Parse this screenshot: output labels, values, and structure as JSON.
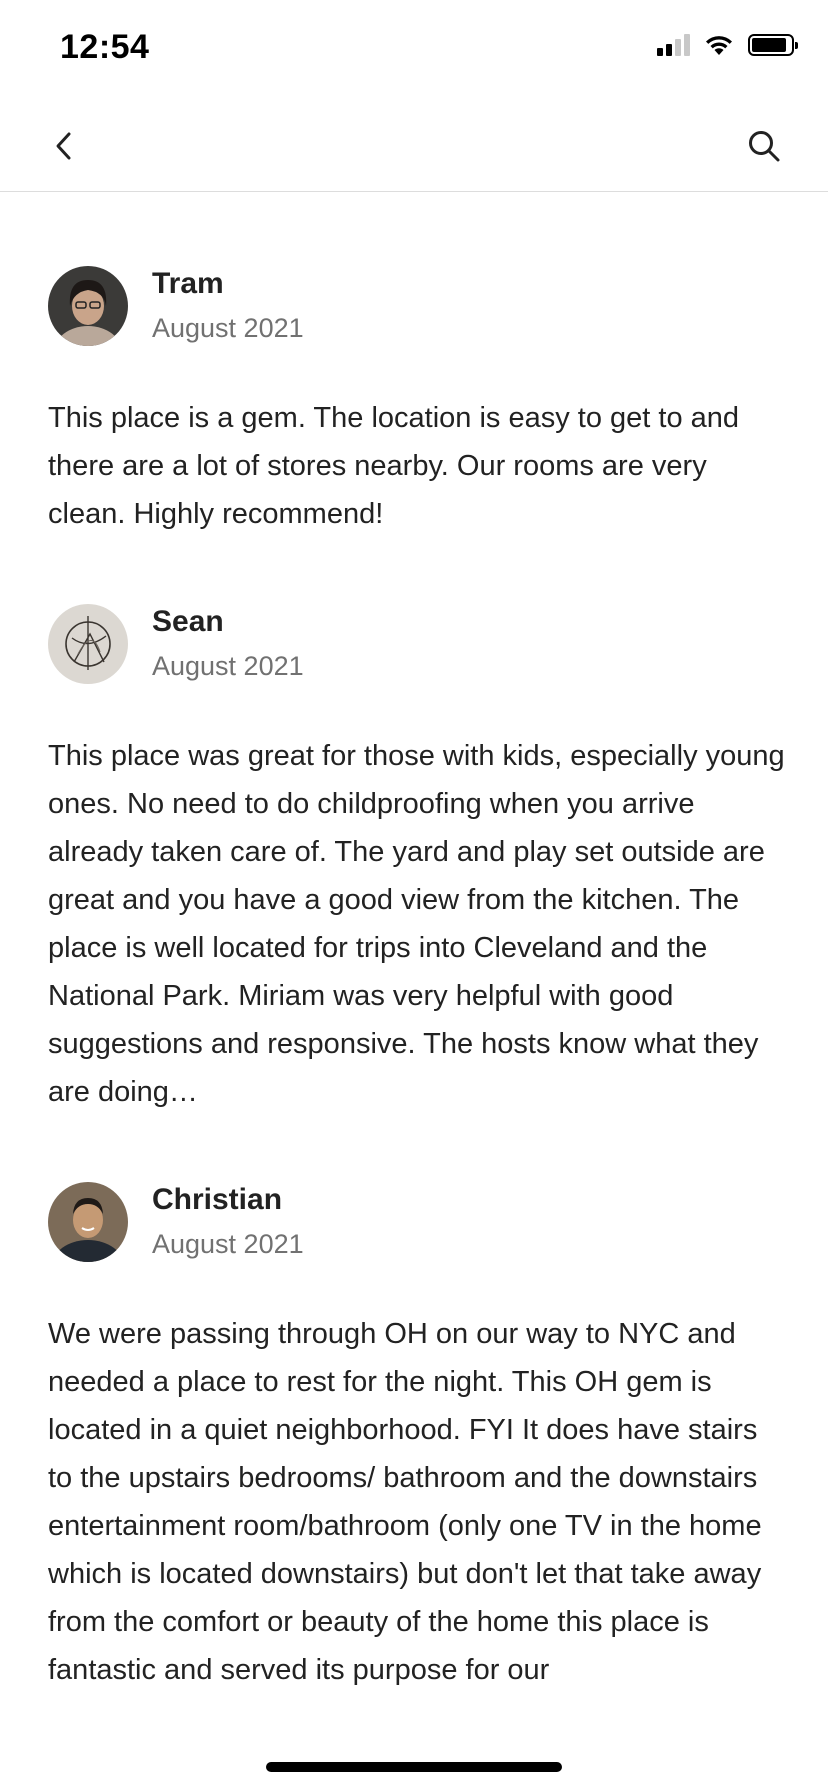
{
  "status_bar": {
    "time": "12:54",
    "icons": [
      "cellular-signal-icon",
      "wifi-icon",
      "battery-icon"
    ]
  },
  "nav": {
    "back_icon": "chevron-left-icon",
    "search_icon": "search-icon"
  },
  "colors": {
    "text_primary": "#222222",
    "text_secondary": "#717171",
    "divider": "#dddddd"
  },
  "reviews": [
    {
      "name": "Tram",
      "date": "August 2021",
      "text": "This place is a gem. The location is easy to get to and there are a lot of stores nearby. Our rooms are very clean. Highly recommend!"
    },
    {
      "name": "Sean",
      "date": "August 2021",
      "text": "This place was great for those with kids, especially young ones. No need to do childproofing when you arrive already taken care of. The yard and play set outside are great and you have a good view from the kitchen. The place is well located for trips into Cleveland and the National Park. Miriam was very helpful with good suggestions and responsive. The hosts know what they are doing…"
    },
    {
      "name": "Christian",
      "date": "August 2021",
      "text": "We were passing through OH on our way to NYC and needed a place to rest for the night. This OH gem is located in a quiet neighborhood. FYI It does have stairs to the upstairs bedrooms/ bathroom and the downstairs entertainment room/bathroom (only one TV in the home which is located downstairs) but don't let that take away from the comfort or beauty of the home this place is fantastic and served its purpose for our"
    }
  ]
}
